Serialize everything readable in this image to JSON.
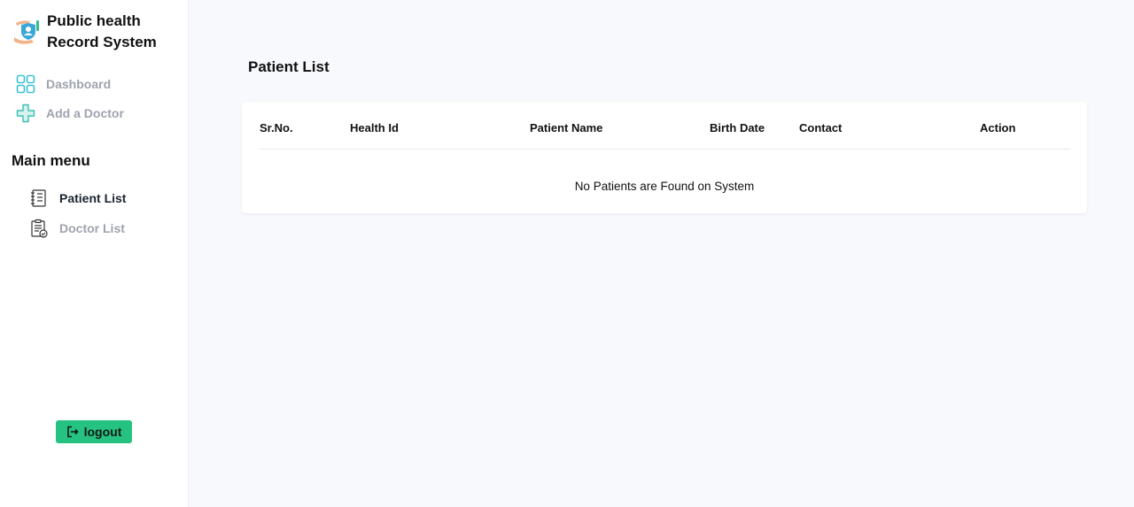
{
  "brand": {
    "title": "Public health Record System",
    "logo_icon": "health-shield-hands-icon"
  },
  "nav": {
    "dashboard": {
      "label": "Dashboard",
      "icon": "grid-icon"
    },
    "add_doctor": {
      "label": "Add a Doctor",
      "icon": "medical-cross-icon"
    }
  },
  "main_menu": {
    "heading": "Main menu",
    "items": [
      {
        "label": "Patient List",
        "icon": "document-list-icon",
        "active": true
      },
      {
        "label": "Doctor List",
        "icon": "clipboard-check-icon",
        "active": false
      }
    ]
  },
  "logout": {
    "label": "logout",
    "icon": "logout-icon"
  },
  "page": {
    "title": "Patient List"
  },
  "table": {
    "columns": [
      "Sr.No.",
      "Health Id",
      "Patient Name",
      "Birth Date",
      "Contact",
      "Action"
    ],
    "rows": [],
    "empty_message": "No Patients are Found on System"
  },
  "colors": {
    "accent": "#25c281",
    "sidebar_bg": "#ffffff",
    "page_bg": "#f8f9fd",
    "muted_text": "#9ea3ad"
  }
}
